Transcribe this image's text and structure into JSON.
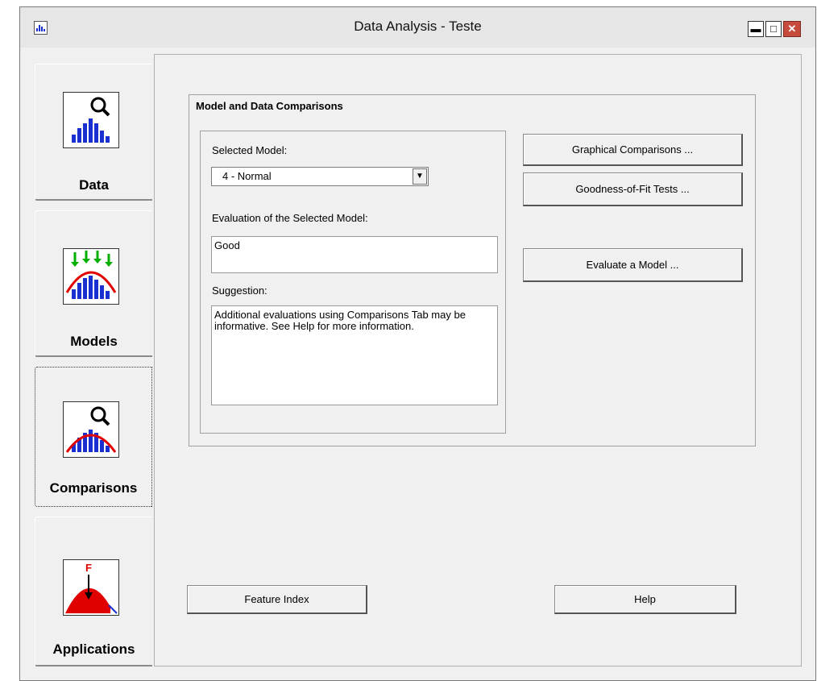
{
  "window": {
    "title": "Data Analysis - Teste",
    "min_glyph": "▬",
    "max_glyph": "□",
    "close_glyph": "✕"
  },
  "tabs": [
    {
      "label": "Data"
    },
    {
      "label": "Models"
    },
    {
      "label": "Comparisons"
    },
    {
      "label": "Applications"
    }
  ],
  "group": {
    "title": "Model and Data Comparisons"
  },
  "model": {
    "selected_label": "Selected Model:",
    "selected_value": "4 - Normal",
    "evaluation_label": "Evaluation of the Selected Model:",
    "evaluation_value": "Good",
    "suggestion_label": "Suggestion:",
    "suggestion_value": "Additional evaluations using Comparisons Tab may be informative. See Help for more information."
  },
  "buttons": {
    "graphical": "Graphical Comparisons ...",
    "goodness": "Goodness-of-Fit Tests ...",
    "evaluate": "Evaluate a Model ...",
    "feature_index": "Feature Index",
    "help": "Help"
  },
  "icon_letter": "F",
  "colors": {
    "close": "#c74b3c",
    "bars": "#1a2fd0",
    "curve": "#e00000",
    "arrows": "#00c000"
  }
}
